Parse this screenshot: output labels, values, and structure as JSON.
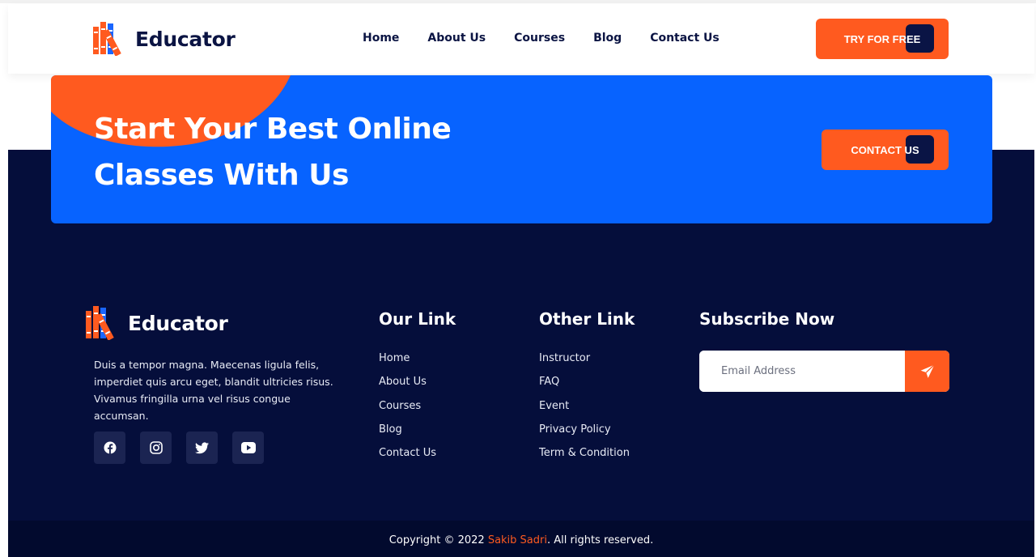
{
  "brand": {
    "name": "Educator"
  },
  "nav": {
    "items": [
      "Home",
      "About Us",
      "Courses",
      "Blog",
      "Contact Us"
    ]
  },
  "header": {
    "cta_label": "Try For Free"
  },
  "cta": {
    "title_line1": "Start Your Best Online",
    "title_line2": "Classes With Us",
    "button_label": "Contact Us"
  },
  "footer": {
    "description": "Duis a tempor magna. Maecenas ligula felis, imperdiet quis arcu eget, blandit ultricies risus. Vivamus fringilla urna vel risus congue accumsan.",
    "socials": [
      "facebook-icon",
      "instagram-icon",
      "twitter-icon",
      "youtube-icon"
    ],
    "our_link": {
      "title": "Our Link",
      "items": [
        "Home",
        "About Us",
        "Courses",
        "Blog",
        "Contact Us"
      ]
    },
    "other_link": {
      "title": "Other Link",
      "items": [
        "Instructor",
        "FAQ",
        "Event",
        "Privacy Policy",
        "Term & Condition"
      ]
    },
    "subscribe": {
      "title": "Subscribe Now",
      "placeholder": "Email Address"
    },
    "copyright": {
      "prefix": "Copyright © 2022 ",
      "author": "Sakib Sadri",
      "suffix": ". All rights reserved."
    }
  },
  "colors": {
    "accent": "#ff5a1f",
    "navy": "#050e3b",
    "blue": "#0763ff"
  }
}
